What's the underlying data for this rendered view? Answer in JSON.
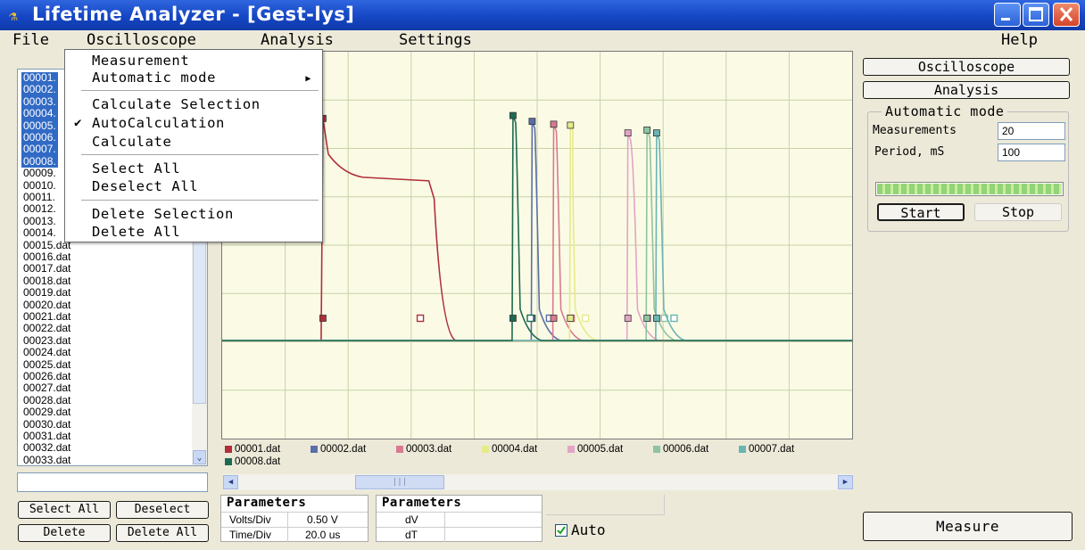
{
  "window": {
    "title": "Lifetime Analyzer - [Gest-lys]",
    "icon": "app-flask-icon"
  },
  "menubar": {
    "file": "File",
    "oscilloscope": "Oscilloscope",
    "analysis": "Analysis",
    "settings": "Settings",
    "help": "Help"
  },
  "dropdown": {
    "measurement": "Measurement",
    "automatic_mode": "Automatic mode",
    "calculate_selection": "Calculate Selection",
    "autocalculation": "AutoCalculation",
    "autocalculation_checked": true,
    "calculate": "Calculate",
    "select_all": "Select All",
    "deselect_all": "Deselect All",
    "delete_selection": "Delete Selection",
    "delete_all": "Delete All"
  },
  "file_list": {
    "items": [
      {
        "label": "00001.",
        "selected": true
      },
      {
        "label": "00002.",
        "selected": true
      },
      {
        "label": "00003.",
        "selected": true
      },
      {
        "label": "00004.",
        "selected": true
      },
      {
        "label": "00005.",
        "selected": true
      },
      {
        "label": "00006.",
        "selected": true
      },
      {
        "label": "00007.",
        "selected": true
      },
      {
        "label": "00008.",
        "selected": true
      },
      {
        "label": "00009.",
        "selected": false
      },
      {
        "label": "00010.",
        "selected": false
      },
      {
        "label": "00011.",
        "selected": false
      },
      {
        "label": "00012.",
        "selected": false
      },
      {
        "label": "00013.",
        "selected": false
      },
      {
        "label": "00014.",
        "selected": false
      },
      {
        "label": "00015.dat",
        "selected": false
      },
      {
        "label": "00016.dat",
        "selected": false
      },
      {
        "label": "00017.dat",
        "selected": false
      },
      {
        "label": "00018.dat",
        "selected": false
      },
      {
        "label": "00019.dat",
        "selected": false
      },
      {
        "label": "00020.dat",
        "selected": false
      },
      {
        "label": "00021.dat",
        "selected": false
      },
      {
        "label": "00022.dat",
        "selected": false
      },
      {
        "label": "00023.dat",
        "selected": false
      },
      {
        "label": "00024.dat",
        "selected": false
      },
      {
        "label": "00025.dat",
        "selected": false
      },
      {
        "label": "00026.dat",
        "selected": false
      },
      {
        "label": "00027.dat",
        "selected": false
      },
      {
        "label": "00028.dat",
        "selected": false
      },
      {
        "label": "00029.dat",
        "selected": false
      },
      {
        "label": "00030.dat",
        "selected": false
      },
      {
        "label": "00031.dat",
        "selected": false
      },
      {
        "label": "00032.dat",
        "selected": false
      },
      {
        "label": "00033.dat",
        "selected": false
      }
    ]
  },
  "left_buttons": {
    "select_all": "Select All",
    "deselect": "Deselect",
    "delete": "Delete",
    "delete_all": "Delete All"
  },
  "legend": [
    {
      "name": "00001.dat",
      "color": "#b0303a"
    },
    {
      "name": "00002.dat",
      "color": "#5a6fa8"
    },
    {
      "name": "00003.dat",
      "color": "#d77a92"
    },
    {
      "name": "00004.dat",
      "color": "#e6ea8a"
    },
    {
      "name": "00005.dat",
      "color": "#e3a4c6"
    },
    {
      "name": "00006.dat",
      "color": "#8ec4a0"
    },
    {
      "name": "00007.dat",
      "color": "#6ab4b4"
    },
    {
      "name": "00008.dat",
      "color": "#1d6a52"
    }
  ],
  "params_left": {
    "title": "Parameters",
    "rows": [
      {
        "label": "Volts/Div",
        "value": "0.50 V"
      },
      {
        "label": "Time/Div",
        "value": "20.0 us"
      }
    ]
  },
  "params_right": {
    "title": "Parameters",
    "rows": [
      {
        "label": "dV",
        "value": ""
      },
      {
        "label": "dT",
        "value": ""
      }
    ]
  },
  "auto_checkbox": {
    "label": "Auto",
    "checked": true
  },
  "right_panel": {
    "oscilloscope_button": "Oscilloscope",
    "analysis_button": "Analysis",
    "automatic_mode_title": "Automatic mode",
    "measurements_label": "Measurements",
    "measurements_value": "20",
    "period_label": "Period, mS",
    "period_value": "100",
    "progress_fraction": 1.0,
    "start_button": "Start",
    "stop_button": "Stop",
    "measure_button": "Measure"
  },
  "chart_data": {
    "type": "line",
    "grid": true,
    "series": [
      {
        "name": "00001.dat",
        "color": "#b0303a",
        "rise": 0.203,
        "drop": 0.385,
        "high": 0.345
      },
      {
        "name": "00002.dat",
        "color": "#5a6fa8",
        "rise": 0.64,
        "drop": 0.655,
        "high": 0.36
      },
      {
        "name": "00003.dat",
        "color": "#d77a92",
        "rise": 0.685,
        "drop": 0.7,
        "high": 0.375
      },
      {
        "name": "00004.dat",
        "color": "#e6ea8a",
        "rise": 0.72,
        "drop": 0.73,
        "high": 0.38
      },
      {
        "name": "00005.dat",
        "color": "#e3a4c6",
        "rise": 0.84,
        "drop": 0.86,
        "high": 0.42
      },
      {
        "name": "00006.dat",
        "color": "#8ec4a0",
        "rise": 0.88,
        "drop": 0.895,
        "high": 0.405
      },
      {
        "name": "00007.dat",
        "color": "#6ab4b4",
        "rise": 0.9,
        "drop": 0.915,
        "high": 0.42
      },
      {
        "name": "00008.dat",
        "color": "#1d6a52",
        "rise": 0.6,
        "drop": 0.615,
        "high": 0.33
      }
    ]
  }
}
